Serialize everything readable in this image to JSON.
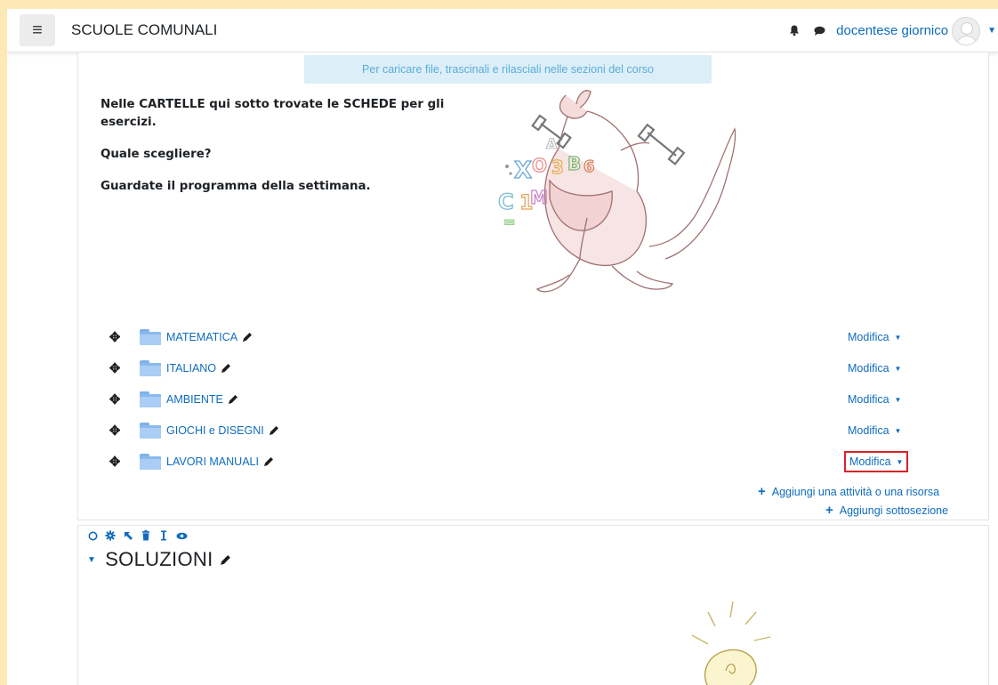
{
  "navbar": {
    "menu_icon": "hamburger-icon",
    "site_name": "SCUOLE COMUNALI",
    "notification_icon": "bell-icon",
    "messages_icon": "chat-bubble-icon",
    "user_name": "docentese giornico",
    "avatar_icon": "user-avatar-icon"
  },
  "dropzone": {
    "text": "Per caricare file, trascinali e rilasciali nelle sezioni del corso"
  },
  "intro": {
    "line1": "Nelle CARTELLE qui sotto trovate le SCHEDE per gli esercizi.",
    "line2": "Quale scegliere?",
    "line3": "Guardate il programma della settimana."
  },
  "activities": [
    {
      "name": "MATEMATICA",
      "action": "Modifica"
    },
    {
      "name": "ITALIANO",
      "action": "Modifica"
    },
    {
      "name": "AMBIENTE",
      "action": "Modifica"
    },
    {
      "name": "GIOCHI e DISEGNI",
      "action": "Modifica"
    },
    {
      "name": "LAVORI MANUALI",
      "action": "Modifica"
    }
  ],
  "add_links": {
    "activity": "Aggiungi una attività o una risorsa",
    "subsection": "Aggiungi sottosezione"
  },
  "section2": {
    "title": "SOLUZIONI"
  },
  "colors": {
    "page_background": "#fde9b4",
    "link": "#0f6cbf",
    "dropzone_bg": "#dceef8",
    "highlight_border": "#d6232b"
  }
}
